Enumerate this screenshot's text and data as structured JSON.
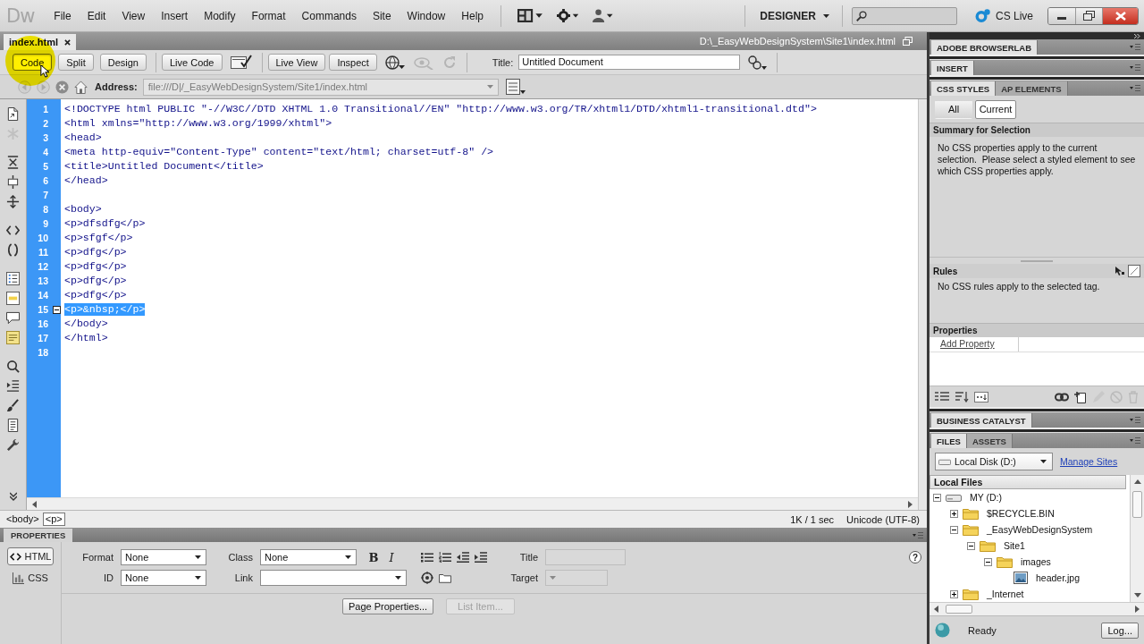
{
  "menubar": {
    "logo": "Dw",
    "menus": [
      "File",
      "Edit",
      "View",
      "Insert",
      "Modify",
      "Format",
      "Commands",
      "Site",
      "Window",
      "Help"
    ],
    "workspace": "DESIGNER",
    "cs_live": "CS Live"
  },
  "document": {
    "tab": {
      "label": "index.html",
      "selected": true
    },
    "path": "D:\\_EasyWebDesignSystem\\Site1\\index.html",
    "view_buttons": [
      {
        "label": "Code",
        "selected": true
      },
      {
        "label": "Split",
        "selected": false
      },
      {
        "label": "Design",
        "selected": false
      }
    ],
    "live_code": "Live Code",
    "live_view": "Live View",
    "inspect": "Inspect",
    "title_label": "Title:",
    "title_value": "Untitled Document",
    "address_label": "Address:",
    "address_value": "file:///D|/_EasyWebDesignSystem/Site1/index.html"
  },
  "code": {
    "lines": [
      {
        "number": "1",
        "text": "<!DOCTYPE html PUBLIC \"-//W3C//DTD XHTML 1.0 Transitional//EN\" \"http://www.w3.org/TR/xhtml1/DTD/xhtml1-transitional.dtd\">",
        "selected": false,
        "collapse_marker": false
      },
      {
        "number": "2",
        "text": "<html xmlns=\"http://www.w3.org/1999/xhtml\">",
        "selected": false,
        "collapse_marker": false
      },
      {
        "number": "3",
        "text": "<head>",
        "selected": false,
        "collapse_marker": false
      },
      {
        "number": "4",
        "text": "<meta http-equiv=\"Content-Type\" content=\"text/html; charset=utf-8\" />",
        "selected": false,
        "collapse_marker": false
      },
      {
        "number": "5",
        "text": "<title>Untitled Document</title>",
        "selected": false,
        "collapse_marker": false
      },
      {
        "number": "6",
        "text": "</head>",
        "selected": false,
        "collapse_marker": false
      },
      {
        "number": "7",
        "selected": false,
        "collapse_marker": false
      },
      {
        "number": "8",
        "text": "<body>",
        "selected": false,
        "collapse_marker": false
      },
      {
        "number": "9",
        "text": "<p>dfsdfg</p>",
        "selected": false,
        "collapse_marker": false
      },
      {
        "number": "10",
        "text": "<p>sfgf</p>",
        "selected": false,
        "collapse_marker": false
      },
      {
        "number": "11",
        "text": "<p>dfg</p>",
        "selected": false,
        "collapse_marker": false
      },
      {
        "number": "12",
        "text": "<p>dfg</p>",
        "selected": false,
        "collapse_marker": false
      },
      {
        "number": "13",
        "text": "<p>dfg</p>",
        "selected": false,
        "collapse_marker": false
      },
      {
        "number": "14",
        "text": "<p>dfg</p>",
        "selected": false,
        "collapse_marker": false
      },
      {
        "number": "15",
        "text": "<p>&nbsp;</p>",
        "selected": true,
        "collapse_marker": true
      },
      {
        "number": "16",
        "text": "</body>",
        "selected": false,
        "collapse_marker": false
      },
      {
        "number": "17",
        "text": "</html>",
        "selected": false,
        "collapse_marker": false
      },
      {
        "number": "18",
        "selected": false,
        "collapse_marker": false
      }
    ]
  },
  "status_bar": {
    "tags": [
      {
        "label": "<body>",
        "selected": false
      },
      {
        "label": "<p>",
        "selected": true
      }
    ],
    "size": "1K / 1 sec",
    "encoding": "Unicode (UTF-8)"
  },
  "properties": {
    "title": "PROPERTIES",
    "modes": [
      {
        "label": "HTML",
        "selected": true
      },
      {
        "label": "CSS",
        "selected": false
      }
    ],
    "format": {
      "label": "Format",
      "value": "None"
    },
    "id": {
      "label": "ID",
      "value": "None"
    },
    "class": {
      "label": "Class",
      "value": "None"
    },
    "link": {
      "label": "Link"
    },
    "style_buttons": [
      "B",
      "I"
    ],
    "title_field": {
      "label": "Title",
      "disabled": true
    },
    "target": {
      "label": "Target",
      "disabled": true
    },
    "help": "?",
    "buttons": [
      {
        "label": "Page Properties...",
        "disabled": false
      },
      {
        "label": "List Item...",
        "disabled": true
      }
    ]
  },
  "panels": {
    "browserlab": "ADOBE BROWSERLAB",
    "insert": "INSERT",
    "css_styles": {
      "tabs": [
        {
          "label": "CSS STYLES",
          "selected": true
        },
        {
          "label": "AP ELEMENTS",
          "selected": false
        }
      ],
      "modes": [
        {
          "label": "All",
          "selected": false
        },
        {
          "label": "Current",
          "selected": true
        }
      ],
      "summary_title": "Summary for Selection",
      "summary_text": "No CSS properties apply to the current selection.  Please select a styled element to see which CSS properties apply.",
      "rules_title": "Rules",
      "rules_text": "No CSS rules apply to the selected tag.",
      "properties_title": "Properties",
      "add_property": "Add Property"
    },
    "business_catalyst": "BUSINESS CATALYST",
    "files": {
      "tabs": [
        {
          "label": "FILES",
          "selected": true
        },
        {
          "label": "ASSETS",
          "selected": false
        }
      ],
      "site": "Local Disk (D:)",
      "manage_link": "Manage Sites",
      "header": "Local Files",
      "tree": [
        {
          "label": "MY (D:)",
          "kind": "drive",
          "expanded": true,
          "children": [
            {
              "label": "$RECYCLE.BIN",
              "kind": "folder",
              "expanded": false
            },
            {
              "label": "_EasyWebDesignSystem",
              "kind": "folder",
              "expanded": true,
              "children": [
                {
                  "label": "Site1",
                  "kind": "folder",
                  "expanded": true,
                  "children": [
                    {
                      "label": "images",
                      "kind": "folder",
                      "expanded": true,
                      "children": [
                        {
                          "label": "header.jpg",
                          "kind": "image"
                        }
                      ]
                    }
                  ]
                }
              ]
            },
            {
              "label": "_Internet",
              "kind": "folder",
              "expanded": false
            }
          ]
        }
      ],
      "status": "Ready",
      "log_button": "Log..."
    }
  }
}
